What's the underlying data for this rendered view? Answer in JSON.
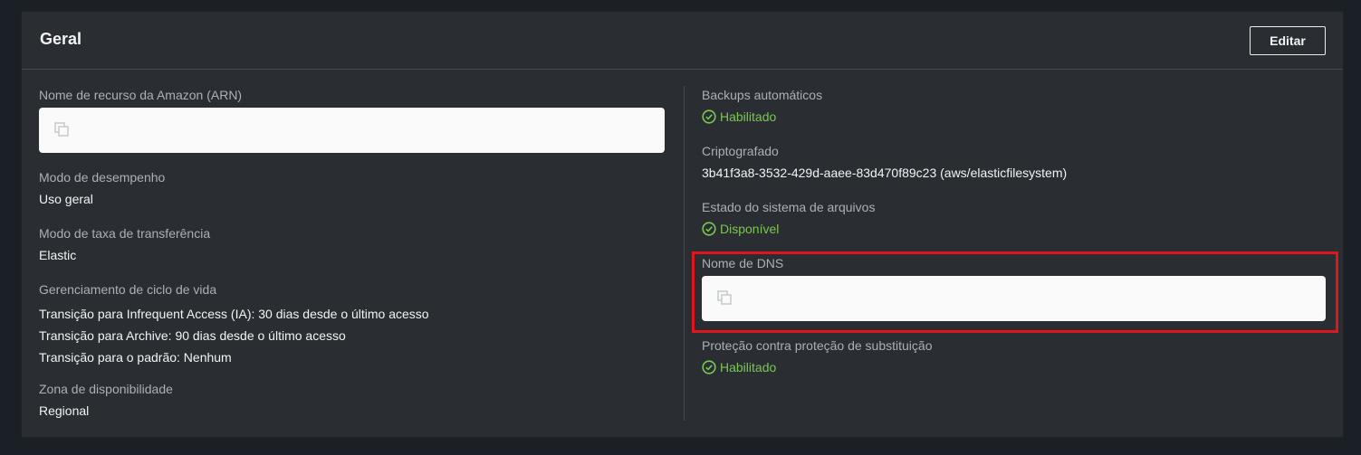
{
  "panel": {
    "title": "Geral",
    "edit_label": "Editar"
  },
  "left": {
    "arn": {
      "label": "Nome de recurso da Amazon (ARN)",
      "icon": "copy-icon"
    },
    "performance_mode": {
      "label": "Modo de desempenho",
      "value": "Uso geral"
    },
    "throughput_mode": {
      "label": "Modo de taxa de transferência",
      "value": "Elastic"
    },
    "lifecycle": {
      "label": "Gerenciamento de ciclo de vida",
      "lines": [
        "Transição para Infrequent Access (IA): 30 dias desde o último acesso",
        "Transição para Archive: 90 dias desde o último acesso",
        "Transição para o padrão: Nenhum"
      ]
    },
    "availability_zone": {
      "label": "Zona de disponibilidade",
      "value": "Regional"
    }
  },
  "right": {
    "backups": {
      "label": "Backups automáticos",
      "value": "Habilitado",
      "icon": "check-circle-icon"
    },
    "encrypted": {
      "label": "Criptografado",
      "value": "3b41f3a8-3532-429d-aaee-83d470f89c23 (aws/elasticfilesystem)"
    },
    "fs_state": {
      "label": "Estado do sistema de arquivos",
      "value": "Disponível",
      "icon": "check-circle-icon"
    },
    "dns_name": {
      "label": "Nome de DNS",
      "icon": "copy-icon"
    },
    "replication_protection": {
      "label": "Proteção contra proteção de substituição",
      "value": "Habilitado",
      "icon": "check-circle-icon"
    }
  },
  "colors": {
    "status_green": "#7ac74f",
    "highlight_red": "#e0161e",
    "panel_bg": "#2a2e33"
  }
}
